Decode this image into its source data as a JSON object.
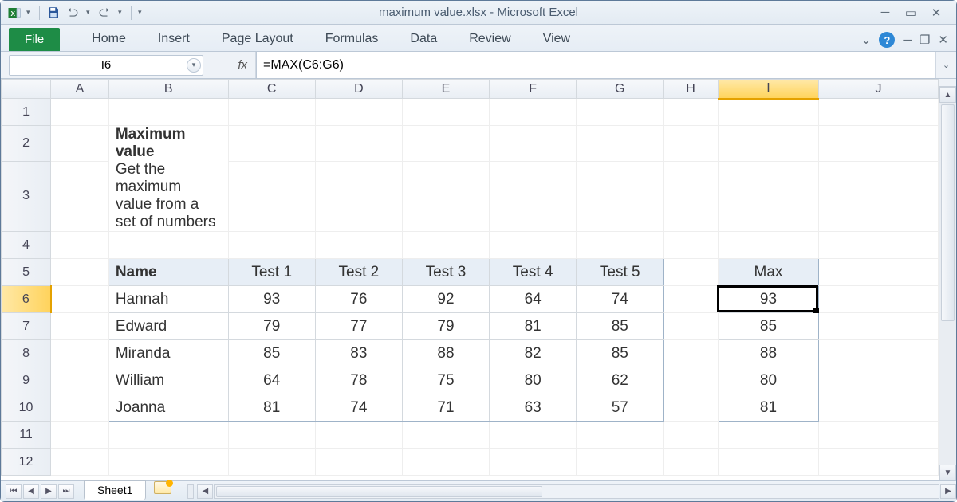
{
  "window": {
    "title": "maximum value.xlsx  -  Microsoft Excel"
  },
  "ribbon": {
    "file": "File",
    "tabs": [
      "Home",
      "Insert",
      "Page Layout",
      "Formulas",
      "Data",
      "Review",
      "View"
    ]
  },
  "formula_bar": {
    "namebox": "I6",
    "fx": "fx",
    "formula": "=MAX(C6:G6)"
  },
  "columns": [
    "A",
    "B",
    "C",
    "D",
    "E",
    "F",
    "G",
    "H",
    "I",
    "J"
  ],
  "rows": [
    "1",
    "2",
    "3",
    "4",
    "5",
    "6",
    "7",
    "8",
    "9",
    "10",
    "11",
    "12"
  ],
  "selected": {
    "row": "6",
    "col": "I"
  },
  "content": {
    "title": "Maximum value",
    "subtitle": "Get the maximum value from a set of numbers"
  },
  "table": {
    "headers": [
      "Name",
      "Test 1",
      "Test 2",
      "Test 3",
      "Test 4",
      "Test 5"
    ],
    "max_header": "Max",
    "rows": [
      {
        "name": "Hannah",
        "vals": [
          93,
          76,
          92,
          64,
          74
        ],
        "max": 93
      },
      {
        "name": "Edward",
        "vals": [
          79,
          77,
          79,
          81,
          85
        ],
        "max": 85
      },
      {
        "name": "Miranda",
        "vals": [
          85,
          83,
          88,
          82,
          85
        ],
        "max": 88
      },
      {
        "name": "William",
        "vals": [
          64,
          78,
          75,
          80,
          62
        ],
        "max": 80
      },
      {
        "name": "Joanna",
        "vals": [
          81,
          74,
          71,
          63,
          57
        ],
        "max": 81
      }
    ]
  },
  "status": {
    "sheet": "Sheet1"
  }
}
